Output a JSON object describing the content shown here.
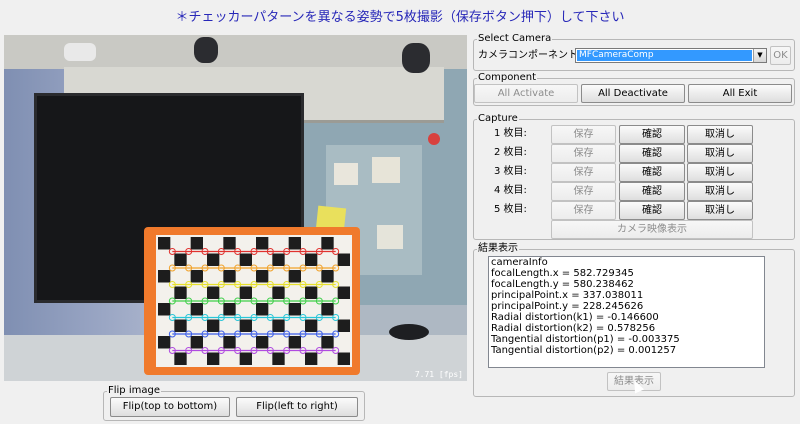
{
  "header": {
    "instruction": "＊チェッカーパターンを異なる姿勢で5枚撮影（保存ボタン押下）して下さい"
  },
  "camera_view": {
    "fps_text": "7.71 [fps]"
  },
  "flip_image": {
    "legend": "Flip image",
    "top_bottom_label": "Flip(top to bottom)",
    "left_right_label": "Flip(left to right)"
  },
  "select_camera": {
    "legend": "Select Camera",
    "label": "カメラコンポーネント",
    "selected_value": "MFCameraComp",
    "ok_label": "OK"
  },
  "component": {
    "legend": "Component",
    "activate_label": "All Activate",
    "deactivate_label": "All Deactivate",
    "exit_label": "All Exit"
  },
  "capture": {
    "legend": "Capture",
    "rows": [
      {
        "label": "1 枚目:",
        "save": "保存",
        "confirm": "確認",
        "cancel": "取消し"
      },
      {
        "label": "2 枚目:",
        "save": "保存",
        "confirm": "確認",
        "cancel": "取消し"
      },
      {
        "label": "3 枚目:",
        "save": "保存",
        "confirm": "確認",
        "cancel": "取消し"
      },
      {
        "label": "4 枚目:",
        "save": "保存",
        "confirm": "確認",
        "cancel": "取消し"
      },
      {
        "label": "5 枚目:",
        "save": "保存",
        "confirm": "確認",
        "cancel": "取消し"
      }
    ],
    "camera_display_label": "カメラ映像表示"
  },
  "result": {
    "legend": "結果表示",
    "lines": [
      "cameraInfo",
      "focalLength.x = 582.729345",
      "focalLength.y = 580.238462",
      "principalPoint.x = 337.038011",
      "principalPoint.y = 228.245626",
      "Radial distortion(k1) = -0.146600",
      "Radial distortion(k2) = 0.578256",
      "Tangential distortion(p1) = -0.003375",
      "Tangential distortion(p2) = 0.001257"
    ],
    "button_label": "結果表示"
  },
  "icons": {
    "dropdown": "chevron-down-icon",
    "cursor": "mouse-pointer-icon"
  },
  "colors": {
    "instruction_text": "#2727b8",
    "selection_highlight": "#3399ff",
    "checker_frame": "#f07a2c"
  }
}
